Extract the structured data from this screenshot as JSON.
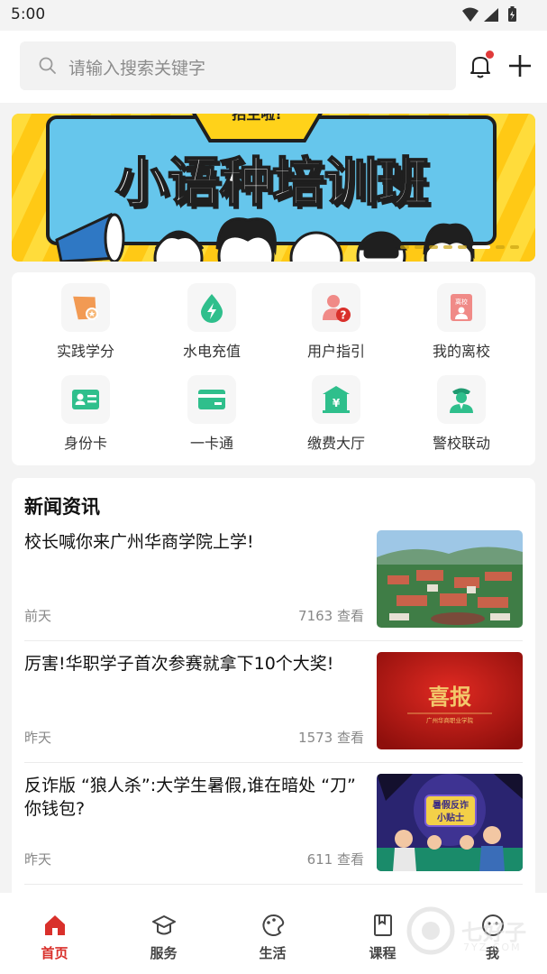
{
  "status": {
    "time": "5:00"
  },
  "search": {
    "placeholder": "请输入搜索关键字"
  },
  "banner": {
    "title": "小语种培训班",
    "top_label": "招生啦!"
  },
  "services": [
    {
      "label": "实践学分",
      "icon": "certificate-flag-icon",
      "color": "#f29a53"
    },
    {
      "label": "水电充值",
      "icon": "water-drop-bolt-icon",
      "color": "#2fbf8c"
    },
    {
      "label": "用户指引",
      "icon": "user-help-icon",
      "color": "#e8534f"
    },
    {
      "label": "我的离校",
      "icon": "leave-school-icon",
      "color": "#e8534f",
      "badge": "离校"
    },
    {
      "label": "身份卡",
      "icon": "id-card-icon",
      "color": "#2fbf8c"
    },
    {
      "label": "一卡通",
      "icon": "campus-card-icon",
      "color": "#2fbf8c"
    },
    {
      "label": "缴费大厅",
      "icon": "payment-hall-icon",
      "color": "#2fbf8c"
    },
    {
      "label": "警校联动",
      "icon": "police-icon",
      "color": "#2fbf8c"
    }
  ],
  "news": {
    "section_title": "新闻资讯",
    "items": [
      {
        "headline": "校长喊你来广州华商学院上学!",
        "date": "前天",
        "views": "7163 查看"
      },
      {
        "headline": "厉害!华职学子首次参赛就拿下10个大奖!",
        "date": "昨天",
        "views": "1573 查看",
        "thumb_title": "喜报",
        "thumb_sub": "广州华商职业学院"
      },
      {
        "headline": "反诈版 “狼人杀”:大学生暑假,谁在暗处 “刀” 你钱包?",
        "date": "昨天",
        "views": "611 查看",
        "thumb_title": "暑假反诈\n小贴士"
      }
    ]
  },
  "nav": [
    {
      "label": "首页",
      "icon": "home-icon",
      "active": true
    },
    {
      "label": "服务",
      "icon": "graduation-cap-icon",
      "active": false
    },
    {
      "label": "生活",
      "icon": "palette-icon",
      "active": false
    },
    {
      "label": "课程",
      "icon": "book-icon",
      "active": false
    },
    {
      "label": "我",
      "icon": "profile-icon",
      "active": false
    }
  ],
  "watermark": {
    "text": "七好子",
    "sub": "7YZ.COM"
  },
  "colors": {
    "accent": "#d9302b",
    "green": "#2fbf8c",
    "banner_yellow": "#ffd21a",
    "banner_blue": "#66c6ec"
  }
}
